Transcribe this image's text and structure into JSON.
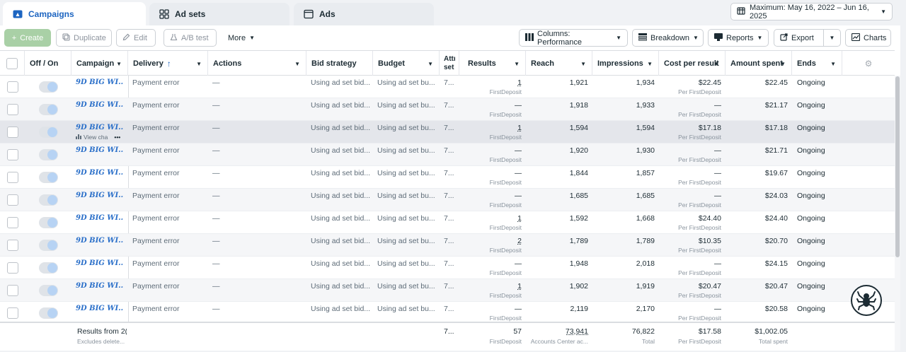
{
  "tabs": [
    {
      "label": "Campaigns",
      "icon": "campaign-folder-icon"
    },
    {
      "label": "Ad sets",
      "icon": "grid-icon"
    },
    {
      "label": "Ads",
      "icon": "ad-window-icon"
    }
  ],
  "date_range": "Maximum: May 16, 2022 – Jun 16, 2025",
  "toolbar": {
    "create": "Create",
    "duplicate": "Duplicate",
    "edit": "Edit",
    "ab_test": "A/B test",
    "more": "More",
    "columns": "Columns: Performance",
    "breakdown": "Breakdown",
    "reports": "Reports",
    "export": "Export",
    "charts": "Charts"
  },
  "columns": {
    "off_on": "Off / On",
    "campaign": "Campaign",
    "delivery": "Delivery",
    "actions": "Actions",
    "bid_strategy": "Bid strategy",
    "budget": "Budget",
    "attribution": "Attr set",
    "results": "Results",
    "reach": "Reach",
    "impressions": "Impressions",
    "cost_per_result": "Cost per result",
    "amount_spent": "Amount spent",
    "ends": "Ends"
  },
  "rows": [
    {
      "campaign": "9D BIG WI...",
      "delivery": "Payment error",
      "actions": "—",
      "bid": "Using ad set bid...",
      "budget": "Using ad set bu...",
      "attr": "7...",
      "results": "1",
      "results_sub": "FirstDeposit",
      "reach": "1,921",
      "impressions": "1,934",
      "cpr": "$22.45",
      "cpr_sub": "Per FirstDeposit",
      "spent": "$22.45",
      "ends": "Ongoing"
    },
    {
      "campaign": "9D BIG WI...",
      "delivery": "Payment error",
      "actions": "—",
      "bid": "Using ad set bid...",
      "budget": "Using ad set bu...",
      "attr": "7...",
      "results": "—",
      "results_sub": "FirstDeposit",
      "reach": "1,918",
      "impressions": "1,933",
      "cpr": "—",
      "cpr_sub": "Per FirstDeposit",
      "spent": "$21.17",
      "ends": "Ongoing"
    },
    {
      "campaign": "9D BIG WI...",
      "view_chart": "View cha",
      "delivery": "Payment error",
      "actions": "—",
      "bid": "Using ad set bid...",
      "budget": "Using ad set bu...",
      "attr": "7...",
      "results": "1",
      "results_sub": "FirstDeposit",
      "reach": "1,594",
      "impressions": "1,594",
      "cpr": "$17.18",
      "cpr_sub": "Per FirstDeposit",
      "spent": "$17.18",
      "ends": "Ongoing"
    },
    {
      "campaign": "9D BIG WI...",
      "delivery": "Payment error",
      "actions": "—",
      "bid": "Using ad set bid...",
      "budget": "Using ad set bu...",
      "attr": "7...",
      "results": "—",
      "results_sub": "FirstDeposit",
      "reach": "1,920",
      "impressions": "1,930",
      "cpr": "—",
      "cpr_sub": "Per FirstDeposit",
      "spent": "$21.71",
      "ends": "Ongoing"
    },
    {
      "campaign": "9D BIG WI...",
      "delivery": "Payment error",
      "actions": "—",
      "bid": "Using ad set bid...",
      "budget": "Using ad set bu...",
      "attr": "7...",
      "results": "—",
      "results_sub": "FirstDeposit",
      "reach": "1,844",
      "impressions": "1,857",
      "cpr": "—",
      "cpr_sub": "Per FirstDeposit",
      "spent": "$19.67",
      "ends": "Ongoing"
    },
    {
      "campaign": "9D BIG WI...",
      "delivery": "Payment error",
      "actions": "—",
      "bid": "Using ad set bid...",
      "budget": "Using ad set bu...",
      "attr": "7...",
      "results": "—",
      "results_sub": "FirstDeposit",
      "reach": "1,685",
      "impressions": "1,685",
      "cpr": "—",
      "cpr_sub": "Per FirstDeposit",
      "spent": "$24.03",
      "ends": "Ongoing"
    },
    {
      "campaign": "9D BIG WI...",
      "delivery": "Payment error",
      "actions": "—",
      "bid": "Using ad set bid...",
      "budget": "Using ad set bu...",
      "attr": "7...",
      "results": "1",
      "results_sub": "FirstDeposit",
      "reach": "1,592",
      "impressions": "1,668",
      "cpr": "$24.40",
      "cpr_sub": "Per FirstDeposit",
      "spent": "$24.40",
      "ends": "Ongoing"
    },
    {
      "campaign": "9D BIG WI...",
      "delivery": "Payment error",
      "actions": "—",
      "bid": "Using ad set bid...",
      "budget": "Using ad set bu...",
      "attr": "7...",
      "results": "2",
      "results_sub": "FirstDeposit",
      "reach": "1,789",
      "impressions": "1,789",
      "cpr": "$10.35",
      "cpr_sub": "Per FirstDeposit",
      "spent": "$20.70",
      "ends": "Ongoing"
    },
    {
      "campaign": "9D BIG WI...",
      "delivery": "Payment error",
      "actions": "—",
      "bid": "Using ad set bid...",
      "budget": "Using ad set bu...",
      "attr": "7...",
      "results": "—",
      "results_sub": "FirstDeposit",
      "reach": "1,948",
      "impressions": "2,018",
      "cpr": "—",
      "cpr_sub": "Per FirstDeposit",
      "spent": "$24.15",
      "ends": "Ongoing"
    },
    {
      "campaign": "9D BIG WI...",
      "delivery": "Payment error",
      "actions": "—",
      "bid": "Using ad set bid...",
      "budget": "Using ad set bu...",
      "attr": "7...",
      "results": "1",
      "results_sub": "FirstDeposit",
      "reach": "1,902",
      "impressions": "1,919",
      "cpr": "$20.47",
      "cpr_sub": "Per FirstDeposit",
      "spent": "$20.47",
      "ends": "Ongoing"
    },
    {
      "campaign": "9D BIG WI...",
      "delivery": "Payment error",
      "actions": "—",
      "bid": "Using ad set bid...",
      "budget": "Using ad set bu...",
      "attr": "7...",
      "results": "—",
      "results_sub": "FirstDeposit",
      "reach": "2,119",
      "impressions": "2,170",
      "cpr": "—",
      "cpr_sub": "Per FirstDeposit",
      "spent": "$20.58",
      "ends": "Ongoing"
    }
  ],
  "footer": {
    "label": "Results from 2(",
    "label_sub": "Excludes delete...",
    "attr": "7...",
    "results": "57",
    "results_sub": "FirstDeposit",
    "reach": "73,941",
    "reach_sub": "Accounts Center ac...",
    "impressions": "76,822",
    "impressions_sub": "Total",
    "cpr": "$17.58",
    "cpr_sub": "Per FirstDeposit",
    "spent": "$1,002.05",
    "spent_sub": "Total spent"
  },
  "colors": {
    "accent": "#1d65c1",
    "create_bg": "#a9d0a6",
    "campaign_link": "#2a6fc9"
  }
}
